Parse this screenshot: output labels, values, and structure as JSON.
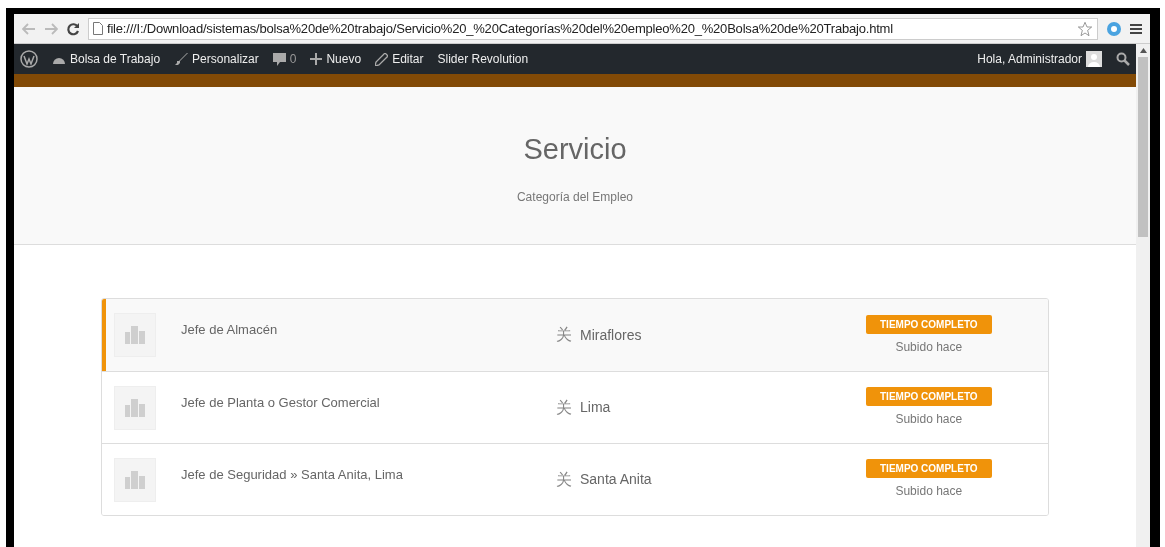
{
  "browser": {
    "url": "file:///I:/Download/sistemas/bolsa%20de%20trabajo/Servicio%20_%20Categorías%20del%20empleo%20_%20Bolsa%20de%20Trabajo.html"
  },
  "admin_bar": {
    "site": "Bolsa de Trabajo",
    "customize": "Personalizar",
    "comments": "0",
    "new": "Nuevo",
    "edit": "Editar",
    "slider": "Slider Revolution",
    "greeting": "Hola, Administrador"
  },
  "header": {
    "title": "Servicio",
    "subtitle": "Categoría del Empleo"
  },
  "jobs": [
    {
      "title": "Jefe de Almacén",
      "location_icon": "关",
      "location": "Miraflores",
      "type": "TIEMPO COMPLETO",
      "posted": "Subido hace",
      "selected": true
    },
    {
      "title": "Jefe de Planta o Gestor Comercial",
      "location_icon": "关",
      "location": "Lima",
      "type": "TIEMPO COMPLETO",
      "posted": "Subido hace",
      "selected": false
    },
    {
      "title": "Jefe de Seguridad » Santa Anita, Lima",
      "location_icon": "关",
      "location": "Santa Anita",
      "type": "TIEMPO COMPLETO",
      "posted": "Subido hace",
      "selected": false
    }
  ]
}
